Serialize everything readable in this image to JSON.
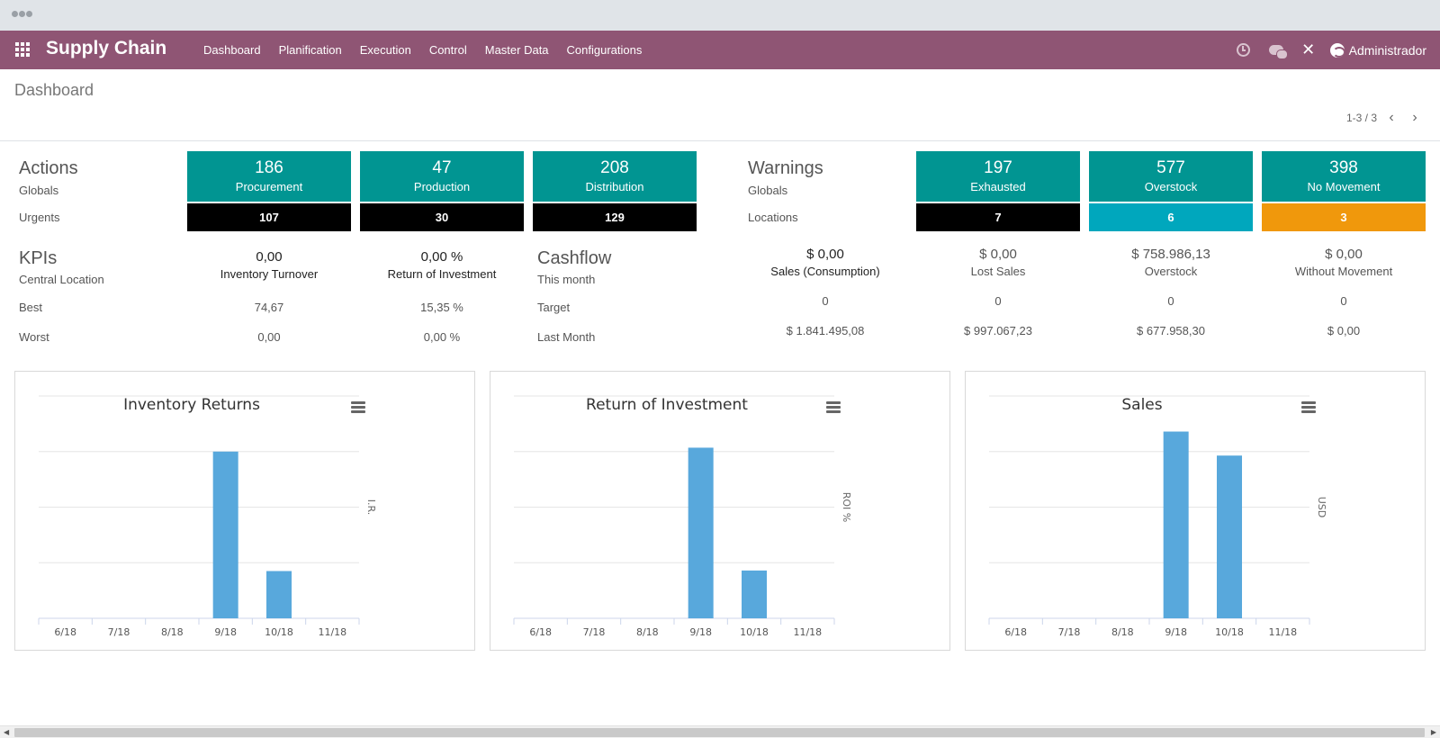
{
  "app": {
    "brand": "Supply Chain",
    "menu": [
      "Dashboard",
      "Planification",
      "Execution",
      "Control",
      "Master Data",
      "Configurations"
    ],
    "user": "Administrador",
    "icons": [
      "apps-icon",
      "clock-icon",
      "chat-icon",
      "tools-icon",
      "avatar-icon"
    ]
  },
  "control": {
    "breadcrumb": "Dashboard",
    "pager": "1-3 / 3",
    "prev": "‹",
    "next": "›"
  },
  "actions": {
    "title": "Actions",
    "globals": "Globals",
    "urgents": "Urgents",
    "tiles": [
      {
        "value": "186",
        "label": "Procurement",
        "urgent": "107"
      },
      {
        "value": "47",
        "label": "Production",
        "urgent": "30"
      },
      {
        "value": "208",
        "label": "Distribution",
        "urgent": "129"
      }
    ]
  },
  "warnings": {
    "title": "Warnings",
    "globals": "Globals",
    "locations": "Locations",
    "tiles": [
      {
        "value": "197",
        "label": "Exhausted",
        "location": "7",
        "location_color": "#000000"
      },
      {
        "value": "577",
        "label": "Overstock",
        "location": "6",
        "location_color": "#00a7bd"
      },
      {
        "value": "398",
        "label": "No Movement",
        "location": "3",
        "location_color": "#f0980c"
      }
    ]
  },
  "kpis": {
    "title": "KPIs",
    "central": "Central Location",
    "best": "Best",
    "worst": "Worst",
    "items": [
      {
        "value": "0,00",
        "label": "Inventory Turnover",
        "best": "74,67",
        "worst": "0,00"
      },
      {
        "value": "0,00 %",
        "label": "Return of Investment",
        "best": "15,35 %",
        "worst": "0,00 %"
      }
    ]
  },
  "cashflow": {
    "title": "Cashflow",
    "this_month": "This month",
    "target": "Target",
    "last_month": "Last Month",
    "items": [
      {
        "value": "$ 0,00",
        "label": "Sales (Consumption)",
        "target": "0",
        "last": "$ 1.841.495,08"
      },
      {
        "value": "$ 0,00",
        "label": "Lost Sales",
        "target": "0",
        "last": "$ 997.067,23"
      },
      {
        "value": "$ 758.986,13",
        "label": "Overstock",
        "target": "0",
        "last": "$ 677.958,30"
      },
      {
        "value": "$ 0,00",
        "label": "Without Movement",
        "target": "0",
        "last": "$ 0,00"
      }
    ]
  },
  "colors": {
    "brand": "#8f5574",
    "tile": "#019592",
    "bar": "#58a8dc"
  },
  "chart_data": [
    {
      "type": "bar",
      "title": "Inventory Returns",
      "ylabel": "I.R.",
      "categories": [
        "6/18",
        "7/18",
        "8/18",
        "9/18",
        "10/18",
        "11/18"
      ],
      "values": [
        0,
        0,
        0,
        3.0,
        0.85,
        0
      ],
      "ylim": [
        0,
        4
      ],
      "grid": true,
      "menu_icon": "hamburger-icon"
    },
    {
      "type": "bar",
      "title": "Return of Investment",
      "ylabel": "ROI %",
      "categories": [
        "6/18",
        "7/18",
        "8/18",
        "9/18",
        "10/18",
        "11/18"
      ],
      "values": [
        0,
        0,
        0,
        15.35,
        4.3,
        0
      ],
      "ylim": [
        0,
        20
      ],
      "grid": true,
      "menu_icon": "hamburger-icon"
    },
    {
      "type": "bar",
      "title": "Sales",
      "ylabel": "USD",
      "categories": [
        "6/18",
        "7/18",
        "8/18",
        "9/18",
        "10/18",
        "11/18"
      ],
      "values": [
        0,
        0,
        0,
        2100000,
        1830000,
        0
      ],
      "ylim": [
        0,
        2500000
      ],
      "grid": true,
      "menu_icon": "hamburger-icon"
    }
  ]
}
